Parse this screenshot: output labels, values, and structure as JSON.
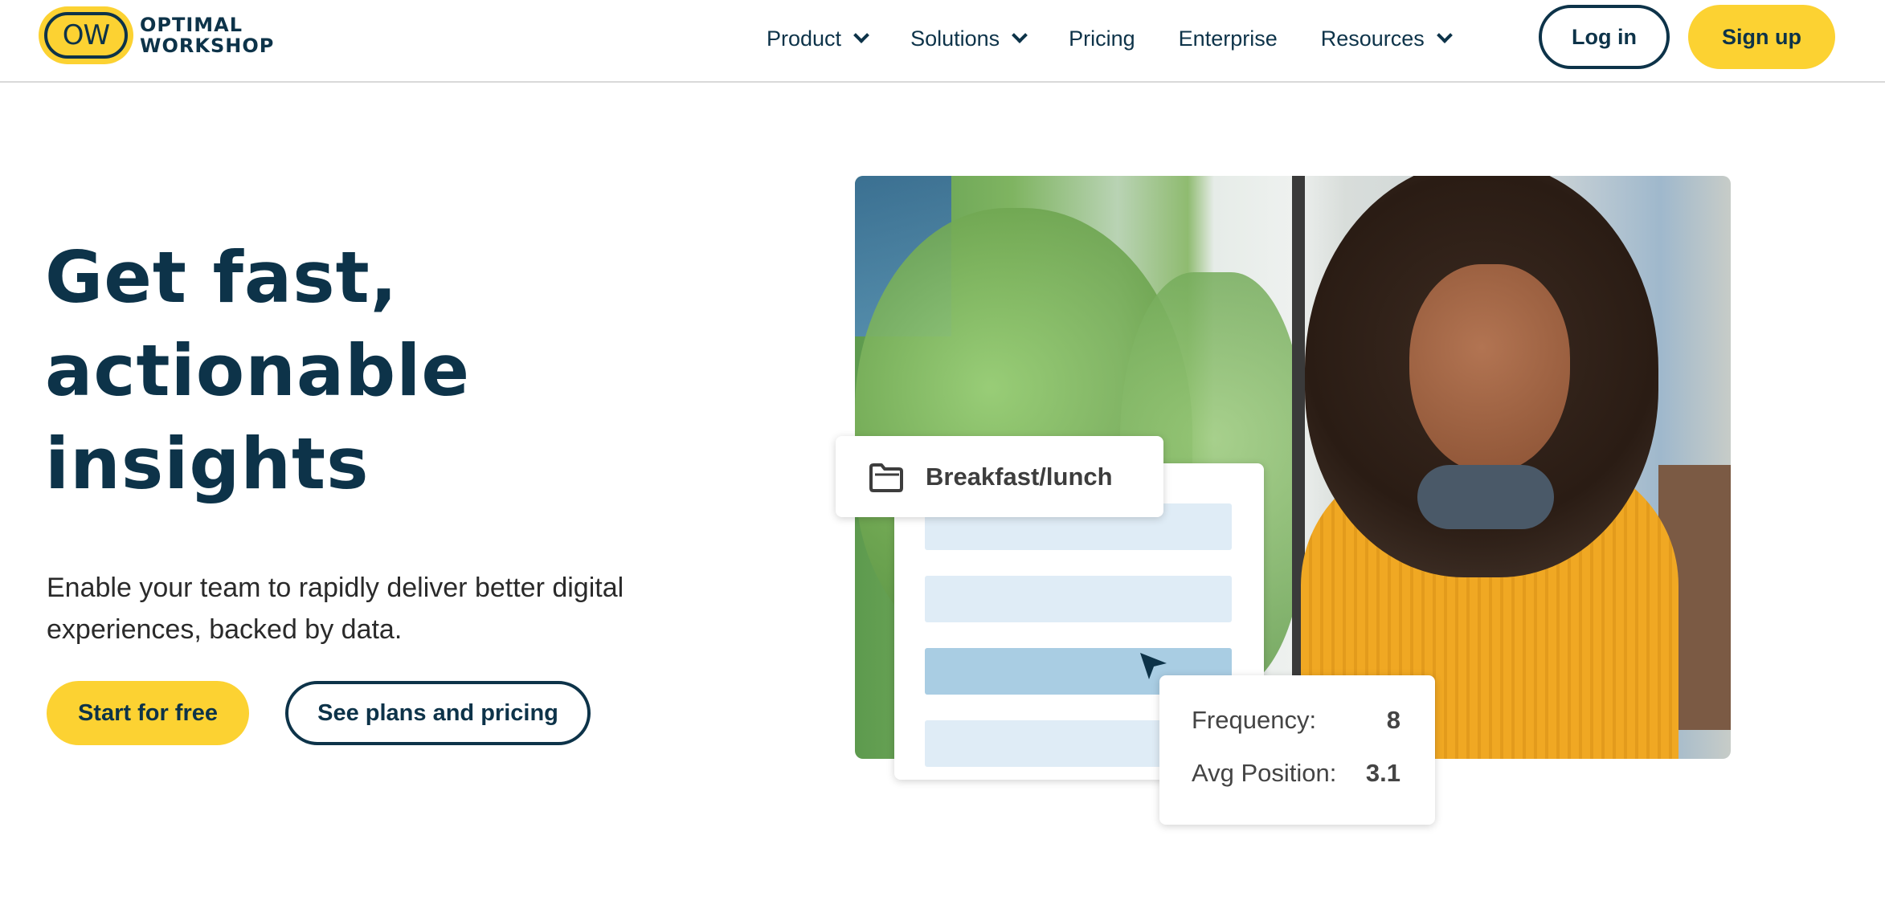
{
  "header": {
    "logo": {
      "mark": "OW",
      "line1": "OPTIMAL",
      "line2": "WORKSHOP"
    },
    "nav": [
      {
        "label": "Product",
        "has_dropdown": true
      },
      {
        "label": "Solutions",
        "has_dropdown": true
      },
      {
        "label": "Pricing",
        "has_dropdown": false
      },
      {
        "label": "Enterprise",
        "has_dropdown": false
      },
      {
        "label": "Resources",
        "has_dropdown": true
      }
    ],
    "login_label": "Log in",
    "signup_label": "Sign up"
  },
  "hero": {
    "title_lines": [
      "Get fast,",
      "actionable",
      "insights"
    ],
    "subtitle": "Enable your team to rapidly deliver better digital experiences, backed by data.",
    "primary_cta": "Start for free",
    "secondary_cta": "See plans and pricing"
  },
  "illustration": {
    "folder_label": "Breakfast/lunch",
    "folder_icon": "folder-icon",
    "list_bar_count": 4,
    "active_bar_index": 2,
    "stats": [
      {
        "label": "Frequency:",
        "value": "8"
      },
      {
        "label": "Avg Position:",
        "value": "3.1"
      }
    ]
  },
  "colors": {
    "brand_yellow": "#fcd232",
    "navy": "#0d3349",
    "bar_light": "#dfecf6",
    "bar_active": "#a9cde3"
  }
}
